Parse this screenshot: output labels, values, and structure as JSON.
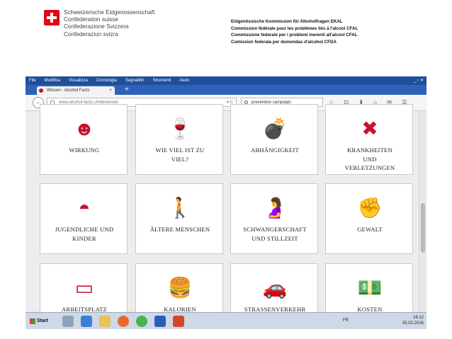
{
  "header": {
    "org_lines": [
      "Schweizerische Eidgenossenschaft",
      "Confédération suisse",
      "Confederazione Svizzera",
      "Confederaziun svizra"
    ],
    "commission_lines": [
      "Eidgenössische Kommission für Alkoholfragen EKAL",
      "Commission fédérale pour les problèmes liés à l'alcool CFAL",
      "Commissione federale per i problemi inerenti all'alcool CFAL",
      "Cumissiun federala per dumondas d'alcohol CFDA"
    ]
  },
  "browser": {
    "menu": [
      "File",
      "Modifica",
      "Visualizza",
      "Cronologia",
      "Segnalibri",
      "Strumenti",
      "Aiuto"
    ],
    "window_controls": "_ ▫ ✕",
    "tab_title": "Wissen - Alcohol Facts",
    "tab_close": "×",
    "new_tab": "+",
    "back": "←",
    "url": "www.alcohol-facts.ch/de/wissen",
    "url_tools": "▾ C",
    "search_value": "prevention campaign",
    "toolbar_icons": "☆ ⊡ ⬇ ⌂ ✉ ☰"
  },
  "tiles": [
    {
      "label": "WIRKUNG",
      "icon": "dizzy-face-icon",
      "glyph": "☻"
    },
    {
      "label": "WIE VIEL IST ZU\nVIEL?",
      "icon": "wine-glass-icon",
      "glyph": "🍷"
    },
    {
      "label": "ABHÄNGIGKEIT",
      "icon": "bottle-bomb-icon",
      "glyph": "💣"
    },
    {
      "label": "KRANKHEITEN\nUND\nVERLETZUNGEN",
      "icon": "bandage-cross-icon",
      "glyph": "✖"
    },
    {
      "label": "JUGENDLICHE UND\nKINDER",
      "icon": "cap-icon",
      "glyph": "◓"
    },
    {
      "label": "ÄLTERE MENSCHEN",
      "icon": "elderly-person-icon",
      "glyph": "🚶"
    },
    {
      "label": "SCHWANGERSCHAFT\nUND STILLZEIT",
      "icon": "pregnant-woman-icon",
      "glyph": "🤰"
    },
    {
      "label": "GEWALT",
      "icon": "fist-icon",
      "glyph": "✊"
    },
    {
      "label": "ARBEITSPLATZ",
      "icon": "monitor-icon",
      "glyph": "▭"
    },
    {
      "label": "KALORIEN",
      "icon": "burger-icon",
      "glyph": "🍔"
    },
    {
      "label": "STRASSENVERKEHR",
      "icon": "car-icon",
      "glyph": "🚗"
    },
    {
      "label": "KOSTEN",
      "icon": "money-icon",
      "glyph": "💵"
    }
  ],
  "taskbar": {
    "start_label": "Start",
    "tray_lang": "FR",
    "tray_time": "16:12",
    "tray_date": "05.02.2016",
    "accent": "#c8102e"
  }
}
